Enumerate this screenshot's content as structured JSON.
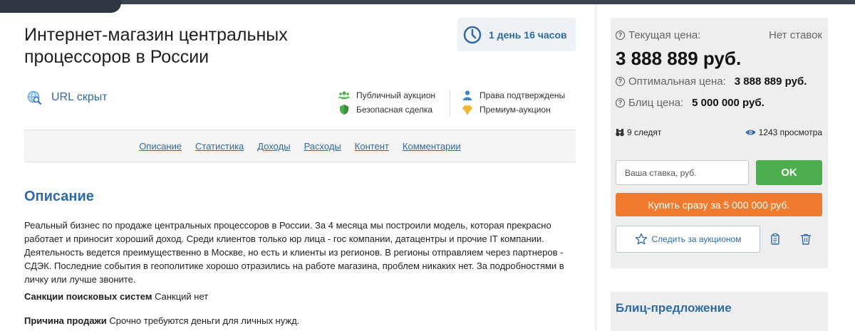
{
  "listing": {
    "title": "Интернет-магазин центральных процессоров в России",
    "time_left": "1 день 16 часов",
    "url_label": "URL скрыт"
  },
  "badges": {
    "public_auction": "Публичный аукцион",
    "safe_deal": "Безопасная сделка",
    "rights_confirmed": "Права подтверждены",
    "premium_auction": "Премиум-аукцион"
  },
  "nav": {
    "items": [
      "Описание",
      "Статистика",
      "Доходы",
      "Расходы",
      "Контент",
      "Комментарии"
    ]
  },
  "description": {
    "heading": "Описание",
    "text": "Реальный бизнес по продаже центральных процессоров в России. За 4 месяца мы построили модель, которая прекрасно работает и приносит хороший доход. Среди клиентов только юр лица - гос компании, датацентры и прочие IT компании. Деятельность ведется преимущественно в Москве, но есть и клиенты из регионов. В регионы отправляем через партнеров - СДЭК. Последние события в геополитике хорошо отразились на работе магазина, проблем никаких нет. За подробностями в личку или лучше звоните.",
    "sanctions_label": "Санкции поисковых систем",
    "sanctions_value": "Санкций нет",
    "reason_label": "Причина продажи",
    "reason_value": "Срочно требуются деньги для личных нужд."
  },
  "pricing": {
    "current_label": "Текущая цена:",
    "no_bids": "Нет ставок",
    "current_price": "3 888 889 руб.",
    "optimal_label": "Оптимальная цена:",
    "optimal_price": "3 888 889 руб.",
    "blitz_label": "Блиц цена:",
    "blitz_price": "5 000 000 руб.",
    "watchers": "9 следят",
    "views": "1243 просмотра",
    "bid_placeholder": "Ваша ставка, руб.",
    "ok_label": "OK",
    "buy_now_label": "Купить сразу за 5 000 000 руб.",
    "follow_label": "Следить за аукционом"
  },
  "blitz": {
    "title": "Блиц-предложение"
  },
  "colors": {
    "accent": "#2f6aa3",
    "ok_green": "#4cae4c",
    "buy_orange": "#f07a2e",
    "panel_bg": "#eeeeee"
  }
}
